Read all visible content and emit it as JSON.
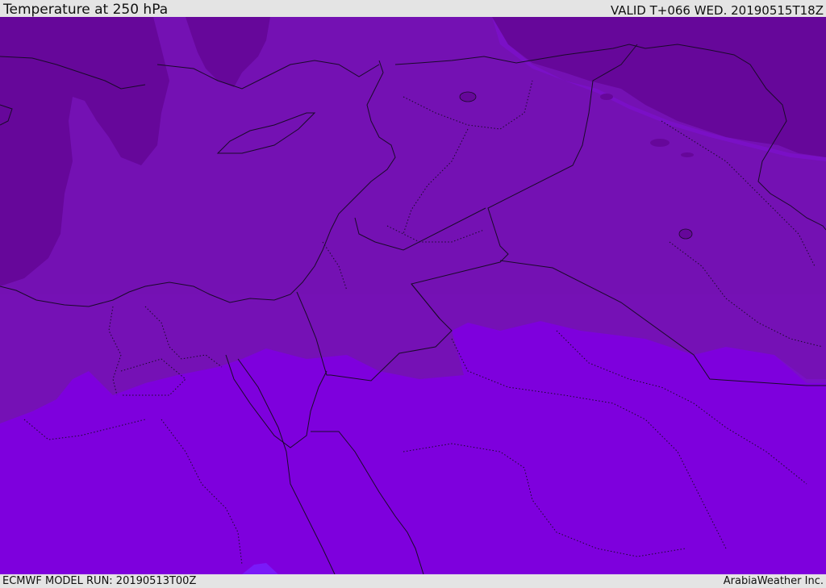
{
  "header": {
    "title": "Temperature at 250 hPa",
    "valid": "VALID T+066 WED. 20190515T18Z"
  },
  "footer": {
    "model_run": "ECMWF MODEL RUN: 20190513T00Z",
    "credit": "ArabiaWeather Inc."
  },
  "colors": {
    "coldest": "#66079a",
    "cold": "#7213b0",
    "mid": "#7e12d6",
    "warm": "#7e00dd",
    "warmest": "#7a1af8",
    "border_line": "#1a0a2a",
    "bar": "#e4e4e4"
  }
}
